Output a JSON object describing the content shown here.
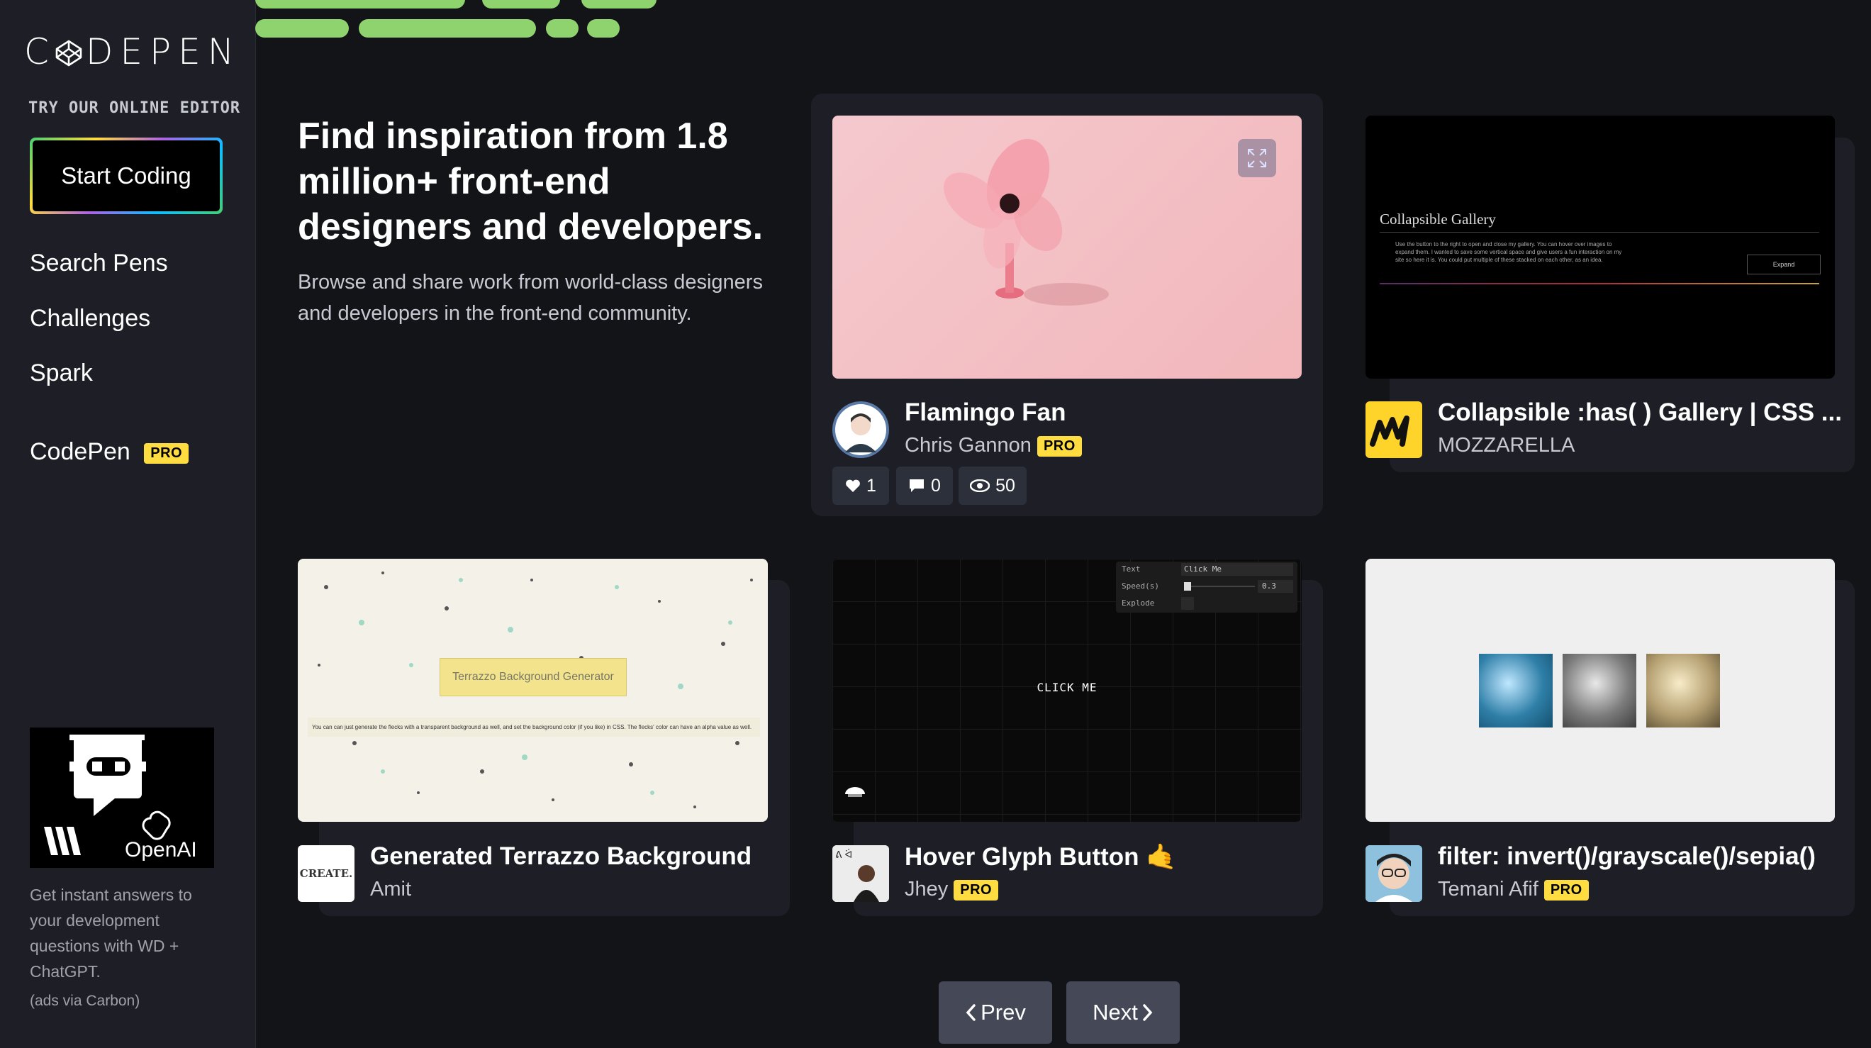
{
  "sidebar": {
    "logo_text": "CODEPEN",
    "try_label": "TRY OUR ONLINE EDITOR",
    "start_coding": "Start Coding",
    "nav": [
      "Search Pens",
      "Challenges",
      "Spark"
    ],
    "codepen_pro": "CodePen",
    "pro_badge": "PRO",
    "ad": {
      "brand": "OpenAI",
      "text": "Get instant answers to your development questions with WD + ChatGPT.",
      "via": "(ads via Carbon)"
    }
  },
  "hero": {
    "title": "Find inspiration from 1.8 million+ front-end designers and developers.",
    "subtitle": "Browse and share work from world-class designers and developers in the front-end community."
  },
  "pens": [
    {
      "title": "Flamingo Fan",
      "author": "Chris Gannon",
      "pro": "PRO",
      "stats": {
        "likes": "1",
        "comments": "0",
        "views": "50"
      }
    },
    {
      "title": "Collapsible :has( ) Gallery | CSS ...",
      "author": "MOZZARELLA",
      "preview": {
        "heading": "Collapsible Gallery",
        "body": "Use the button to the right to open and close my gallery. You can hover over images to expand them. I wanted to save some vertical space and give users a fun interaction on my site so here it is. You could put multiple of these stacked on each other, as an idea.",
        "button": "Expand"
      }
    },
    {
      "title": "Generated Terrazzo Background",
      "author": "Amit",
      "avatar_text": "CREATE.",
      "preview": {
        "label": "Terrazzo Background Generator",
        "note": "You can can just generate the flecks with a transparent background as well, and set the background color (if you like) in CSS. The flecks' color can have an alpha value as well."
      }
    },
    {
      "title": "Hover Glyph Button 🤙",
      "author": "Jhey",
      "pro": "PRO",
      "preview": {
        "button": "CLICK ME",
        "panel": [
          {
            "label": "Text",
            "value": "Click Me"
          },
          {
            "label": "Speed(s)",
            "value": "0.3"
          },
          {
            "label": "Explode",
            "value": ""
          }
        ]
      }
    },
    {
      "title": "filter: invert()/grayscale()/sepia()",
      "author": "Temani Afif",
      "pro": "PRO"
    }
  ],
  "pagination": {
    "prev": "Prev",
    "next": "Next"
  },
  "colors": {
    "background": "#131417",
    "sidebar": "#1e1f26",
    "card": "#1e1f26",
    "pro_badge": "#ffdd40",
    "button": "#444857",
    "accent_green": "#8fd36e"
  }
}
